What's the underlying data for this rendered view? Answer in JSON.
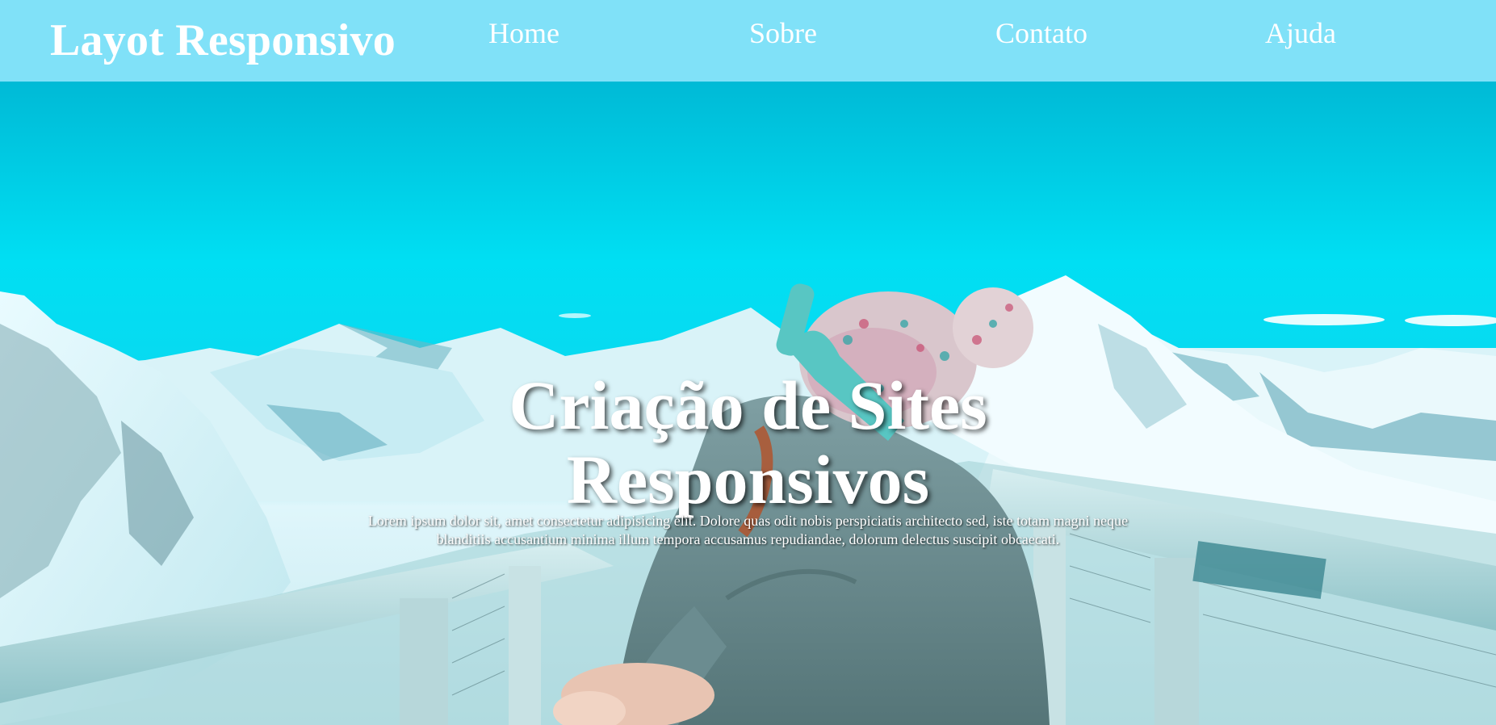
{
  "header": {
    "logo": "Layot Responsivo",
    "nav": [
      "Home",
      "Sobre",
      "Contato",
      "Ajuda"
    ]
  },
  "hero": {
    "title_line1": "Criação de Sites",
    "title_line2": "Responsivos",
    "text": "Lorem ipsum dolor sit, amet consectetur adipisicing elit. Dolore quas odit nobis perspiciatis architecto sed, iste totam magni neque blanditiis accusantium minima illum tempora accusamus repudiandae, dolorum delectus suscipit obcaecati."
  },
  "colors": {
    "header_bg": "#80e1f8",
    "sky": "#00dff3",
    "text": "#ffffff"
  }
}
